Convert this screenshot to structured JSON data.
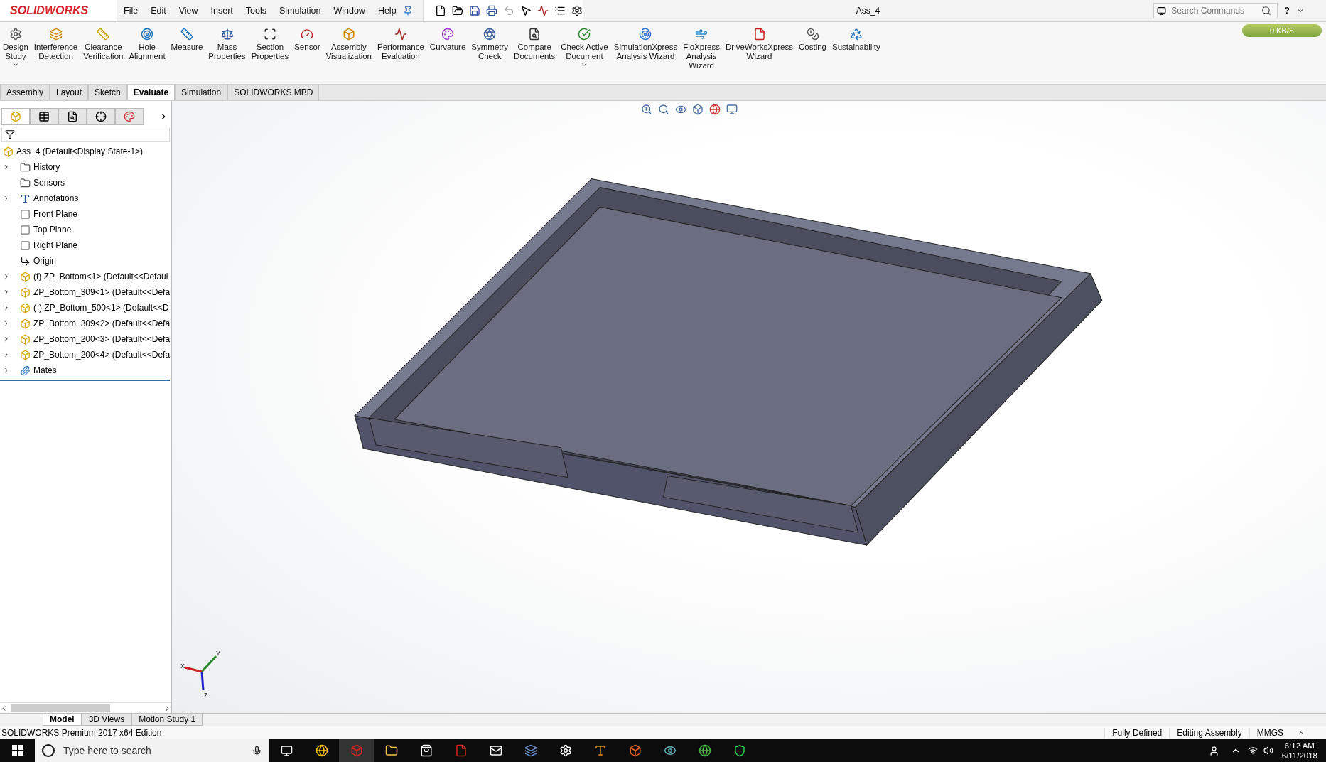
{
  "app": {
    "logo": "SOLIDWORKS",
    "menus": [
      "File",
      "Edit",
      "View",
      "Insert",
      "Tools",
      "Simulation",
      "Window",
      "Help"
    ],
    "title": "Ass_4",
    "search": {
      "placeholder": "Search Commands"
    },
    "help": "?",
    "network": "0 KB/S"
  },
  "commands": [
    {
      "label": "Design\nStudy",
      "dropdown": true
    },
    {
      "label": "Interference\nDetection",
      "dropdown": false
    },
    {
      "label": "Clearance\nVerification",
      "dropdown": false
    },
    {
      "label": "Hole\nAlignment",
      "dropdown": false
    },
    {
      "label": "Measure",
      "dropdown": false
    },
    {
      "label": "Mass\nProperties",
      "dropdown": false
    },
    {
      "label": "Section\nProperties",
      "dropdown": false
    },
    {
      "label": "Sensor",
      "dropdown": false
    },
    {
      "label": "Assembly\nVisualization",
      "dropdown": false
    },
    {
      "label": "Performance\nEvaluation",
      "dropdown": false
    },
    {
      "label": "Curvature",
      "dropdown": false
    },
    {
      "label": "Symmetry\nCheck",
      "dropdown": false
    },
    {
      "label": "Compare\nDocuments",
      "dropdown": false
    },
    {
      "label": "Check Active\nDocument",
      "dropdown": true
    },
    {
      "label": "SimulationXpress\nAnalysis Wizard",
      "dropdown": false
    },
    {
      "label": "FloXpress\nAnalysis\nWizard",
      "dropdown": false
    },
    {
      "label": "DriveWorksXpress\nWizard",
      "dropdown": false
    },
    {
      "label": "Costing",
      "dropdown": false
    },
    {
      "label": "Sustainability",
      "dropdown": false
    }
  ],
  "tabs": [
    {
      "label": "Assembly",
      "selected": false
    },
    {
      "label": "Layout",
      "selected": false
    },
    {
      "label": "Sketch",
      "selected": false
    },
    {
      "label": "Evaluate",
      "selected": true
    },
    {
      "label": "Simulation",
      "selected": false
    },
    {
      "label": "SOLIDWORKS MBD",
      "selected": false
    }
  ],
  "tree": {
    "root": "Ass_4  (Default<Display State-1>)",
    "items": [
      {
        "kind": "history",
        "label": "History",
        "expandable": true
      },
      {
        "kind": "sensors",
        "label": "Sensors",
        "expandable": false
      },
      {
        "kind": "annotations",
        "label": "Annotations",
        "expandable": true
      },
      {
        "kind": "plane",
        "label": "Front Plane",
        "expandable": false
      },
      {
        "kind": "plane",
        "label": "Top Plane",
        "expandable": false
      },
      {
        "kind": "plane",
        "label": "Right Plane",
        "expandable": false
      },
      {
        "kind": "origin",
        "label": "Origin",
        "expandable": false
      },
      {
        "kind": "part",
        "label": "(f) ZP_Bottom<1> (Default<<Defaul",
        "expandable": true
      },
      {
        "kind": "part",
        "label": "ZP_Bottom_309<1> (Default<<Defa",
        "expandable": true
      },
      {
        "kind": "part",
        "label": "(-) ZP_Bottom_500<1> (Default<<D",
        "expandable": true
      },
      {
        "kind": "part",
        "label": "ZP_Bottom_309<2> (Default<<Defa",
        "expandable": true
      },
      {
        "kind": "part",
        "label": "ZP_Bottom_200<3> (Default<<Defa",
        "expandable": true
      },
      {
        "kind": "part",
        "label": "ZP_Bottom_200<4> (Default<<Defa",
        "expandable": true
      },
      {
        "kind": "mates",
        "label": "Mates",
        "expandable": true
      }
    ]
  },
  "triad": {
    "x": "X",
    "y": "Y",
    "z": "Z"
  },
  "bottom_tabs": [
    {
      "label": "Model",
      "selected": true
    },
    {
      "label": "3D Views",
      "selected": false
    },
    {
      "label": "Motion Study 1",
      "selected": false
    }
  ],
  "status": {
    "edition": "SOLIDWORKS Premium 2017 x64 Edition",
    "items": [
      "Fully Defined",
      "Editing Assembly",
      "MMGS"
    ]
  },
  "taskbar": {
    "search": {
      "placeholder": "Type here to search"
    },
    "time": "6:12 AM",
    "date": "6/11/2018"
  }
}
